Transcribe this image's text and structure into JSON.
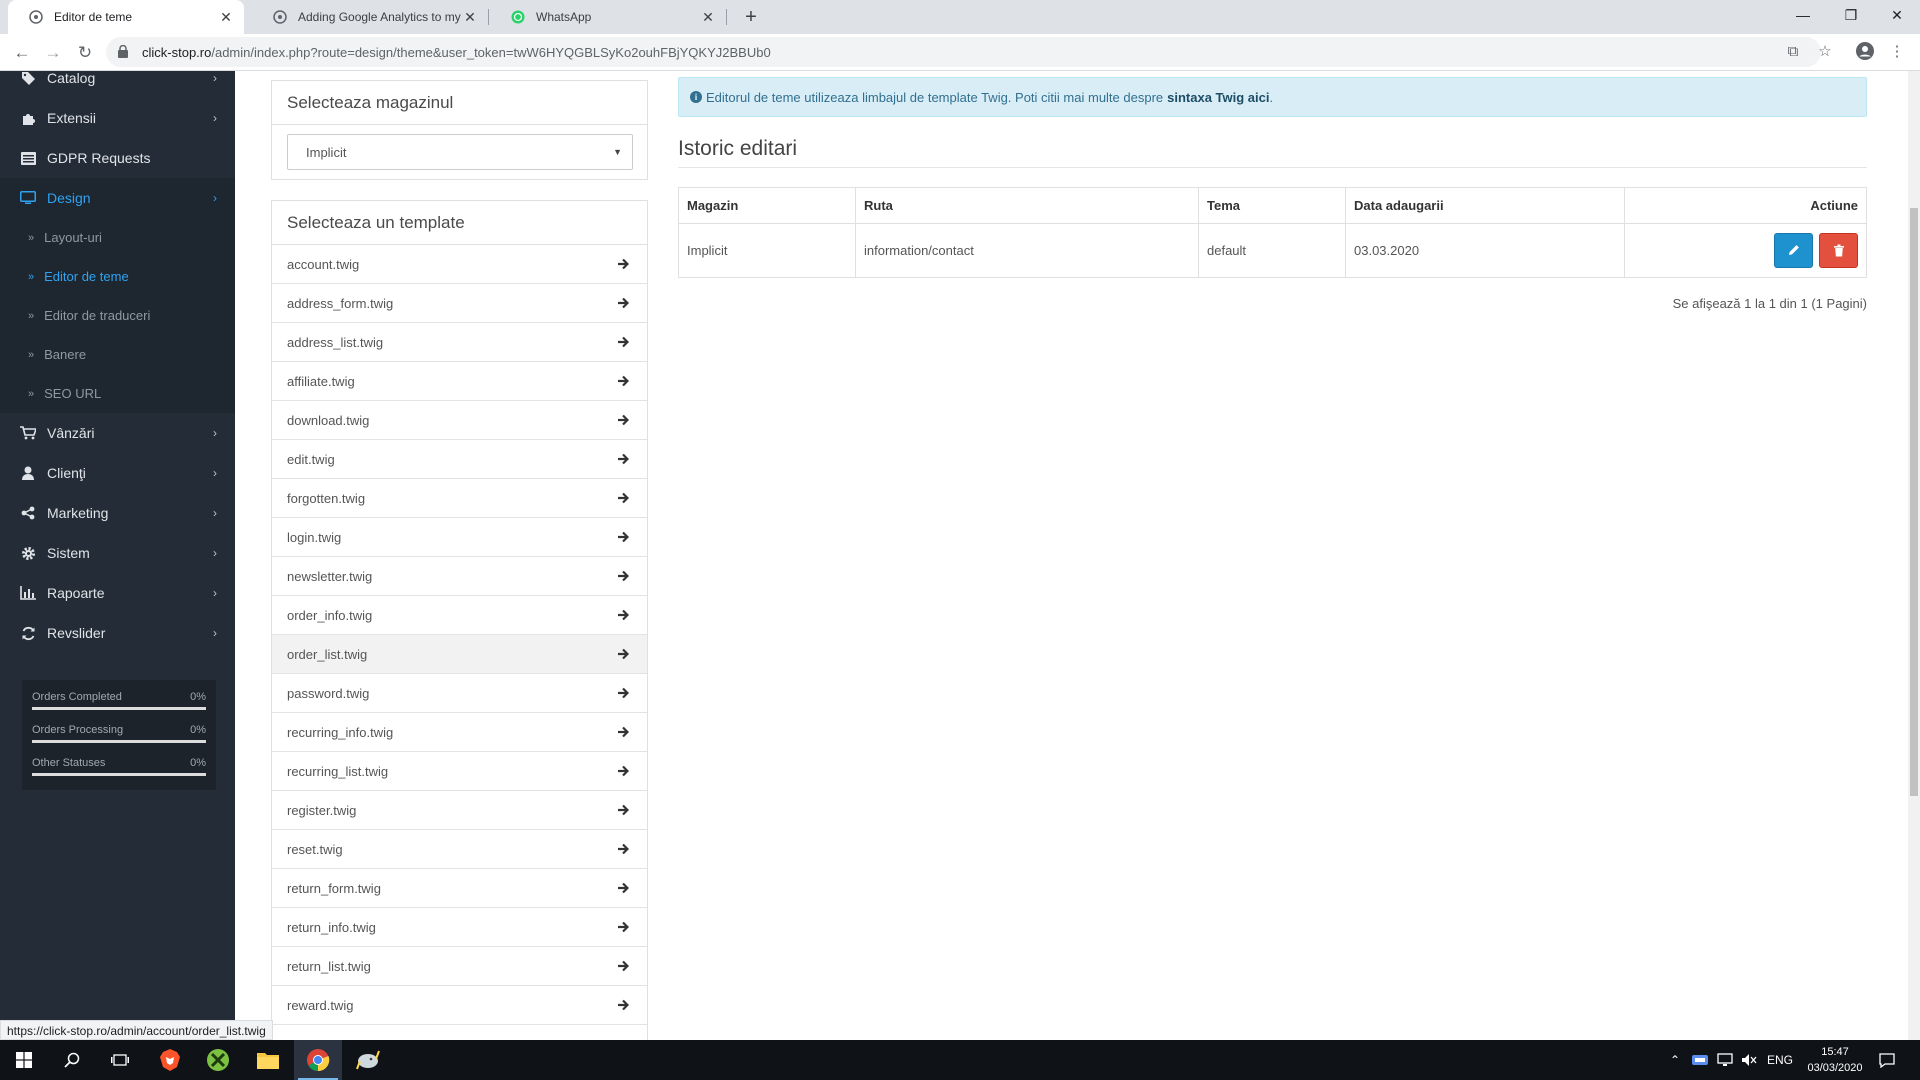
{
  "browser": {
    "tabs": [
      {
        "title": "Editor de teme",
        "active": true
      },
      {
        "title": "Adding Google Analytics to my v",
        "active": false
      },
      {
        "title": "WhatsApp",
        "active": false
      }
    ],
    "url_host": "click-stop.ro",
    "url_path": "/admin/index.php?route=design/theme&user_token=twW6HYQGBLSyKo2ouhFBjYQKYJ2BBUb0",
    "status_url": "https://click-stop.ro/admin/account/order_list.twig"
  },
  "sidebar": {
    "items": [
      {
        "label": "Catalog",
        "icon": "tag-icon"
      },
      {
        "label": "Extensii",
        "icon": "puzzle-icon"
      },
      {
        "label": "GDPR Requests",
        "icon": "list-icon"
      },
      {
        "label": "Design",
        "icon": "monitor-icon"
      },
      {
        "label": "Vânzări",
        "icon": "cart-icon"
      },
      {
        "label": "Clienţi",
        "icon": "user-icon"
      },
      {
        "label": "Marketing",
        "icon": "share-icon"
      },
      {
        "label": "Sistem",
        "icon": "cog-icon"
      },
      {
        "label": "Rapoarte",
        "icon": "bar-chart-icon"
      },
      {
        "label": "Revslider",
        "icon": "refresh-icon"
      }
    ],
    "design_sub": [
      {
        "label": "Layout-uri"
      },
      {
        "label": "Editor de teme"
      },
      {
        "label": "Editor de traduceri"
      },
      {
        "label": "Banere"
      },
      {
        "label": "SEO URL"
      }
    ],
    "stats": [
      {
        "label": "Orders Completed",
        "value": "0%",
        "progress": 0
      },
      {
        "label": "Orders Processing",
        "value": "0%",
        "progress": 0
      },
      {
        "label": "Other Statuses",
        "value": "0%",
        "progress": 0
      }
    ]
  },
  "store_panel": {
    "title": "Selecteaza magazinul",
    "selected": "Implicit"
  },
  "template_panel": {
    "title": "Selecteaza un template",
    "items": [
      "account.twig",
      "address_form.twig",
      "address_list.twig",
      "affiliate.twig",
      "download.twig",
      "edit.twig",
      "forgotten.twig",
      "login.twig",
      "newsletter.twig",
      "order_info.twig",
      "order_list.twig",
      "password.twig",
      "recurring_info.twig",
      "recurring_list.twig",
      "register.twig",
      "reset.twig",
      "return_form.twig",
      "return_info.twig",
      "return_list.twig",
      "reward.twig"
    ]
  },
  "alert": {
    "text": "Editorul de teme utilizeaza limbajul de template Twig. Poti citii mai multe despre",
    "link": "sintaxa Twig aici",
    "end": "."
  },
  "history": {
    "title": "Istoric editari",
    "headers": {
      "store": "Magazin",
      "route": "Ruta",
      "theme": "Tema",
      "date": "Data adaugarii",
      "action": "Actiune"
    },
    "rows": [
      {
        "store": "Implicit",
        "route": "information/contact",
        "theme": "default",
        "date": "03.03.2020"
      }
    ],
    "pager": "Se afişează 1 la 1 din 1 (1 Pagini)"
  },
  "taskbar": {
    "lang": "ENG",
    "time": "15:47",
    "date": "03/03/2020"
  },
  "colors": {
    "sidebar_bg": "#242d37",
    "accent": "#2ea3f2",
    "edit_button": "#1e91cf",
    "delete_button": "#e3503e"
  }
}
